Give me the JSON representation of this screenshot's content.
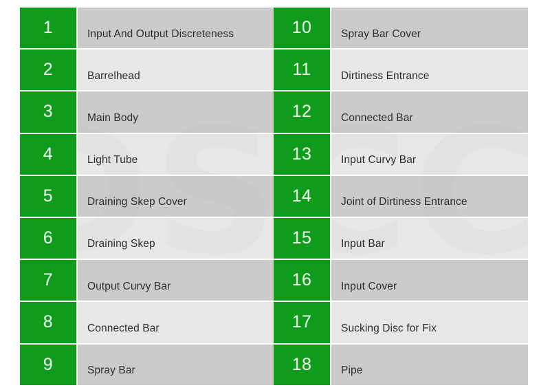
{
  "watermark": {
    "text": "DSCC"
  },
  "table": {
    "columns": [
      {
        "number_header": "",
        "label_header": ""
      },
      {
        "number_header": "",
        "label_header": ""
      }
    ],
    "left_column": [
      {
        "number": "1",
        "label": "Input And Output Discreteness"
      },
      {
        "number": "2",
        "label": "Barrelhead"
      },
      {
        "number": "3",
        "label": "Main Body"
      },
      {
        "number": "4",
        "label": "Light Tube"
      },
      {
        "number": "5",
        "label": "Draining Skep Cover"
      },
      {
        "number": "6",
        "label": "Draining Skep"
      },
      {
        "number": "7",
        "label": "Output Curvy Bar"
      },
      {
        "number": "8",
        "label": "Connected Bar"
      },
      {
        "number": "9",
        "label": "Spray Bar"
      }
    ],
    "right_column": [
      {
        "number": "10",
        "label": "Spray Bar Cover"
      },
      {
        "number": "11",
        "label": "Dirtiness Entrance"
      },
      {
        "number": "12",
        "label": "Connected Bar"
      },
      {
        "number": "13",
        "label": "Input Curvy Bar"
      },
      {
        "number": "14",
        "label": "Joint of Dirtiness Entrance"
      },
      {
        "number": "15",
        "label": "Input Bar"
      },
      {
        "number": "16",
        "label": "Input Cover"
      },
      {
        "number": "17",
        "label": "Sucking Disc for Fix"
      },
      {
        "number": "18",
        "label": "Pipe"
      }
    ]
  },
  "colors": {
    "number_cell_background": "#0f9c1c",
    "number_cell_text": "#eafbe9",
    "row_shade_dark": "#bebebe",
    "row_shade_light": "#dedede",
    "label_text": "#2c2c2c",
    "page_background": "#ffffff",
    "grid_line": "#ffffff"
  }
}
